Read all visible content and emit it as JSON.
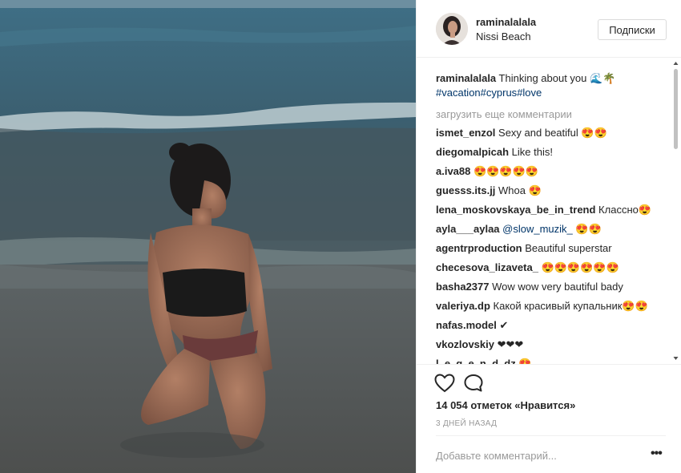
{
  "post": {
    "photo_alt": "",
    "header": {
      "username": "raminalalala",
      "location": "Nissi Beach",
      "follow_label": "Подписки"
    },
    "caption": {
      "username": "raminalalala",
      "text": " Thinking about you 🌊🌴",
      "hashtags": [
        "#vacation",
        "#cyprus",
        "#love"
      ]
    },
    "load_more_label": "загрузить еще комментарии",
    "comments": [
      {
        "username": "ismet_enzol",
        "text": " Sexy and beatiful 😍😍"
      },
      {
        "username": "diegomalpicah",
        "text": " Like this!"
      },
      {
        "username": "a.iva88",
        "text": " 😍😍😍😍😍"
      },
      {
        "username": "guesss.its.jj",
        "text": " Whoa 😍"
      },
      {
        "username": "lena_moskovskaya_be_in_trend",
        "text": " Классно😍"
      },
      {
        "username": "ayla___aylaa",
        "mention": "@slow_muzik_",
        "text": " 😍😍"
      },
      {
        "username": "agentrproduction",
        "text": " Beautiful superstar"
      },
      {
        "username": "checesova_lizaveta_",
        "text": " 😍😍😍😍😍😍"
      },
      {
        "username": "basha2377",
        "text": " Wow wow very bautiful bady"
      },
      {
        "username": "valeriya.dp",
        "text": " Какой красивый купальник😍😍"
      },
      {
        "username": "nafas.model",
        "text": " ✔"
      },
      {
        "username": "vkozlovskiy",
        "text": " ❤❤❤"
      },
      {
        "username": "l_e_g_e_n_d_dz",
        "text": " 😍"
      }
    ],
    "likes_label": "14 054 отметок «Нравится»",
    "time_label": "3 ДНЕЙ НАЗАД",
    "add_comment_placeholder": "Добавьте комментарий...",
    "more_label": "•••",
    "icons": {
      "like": "heart-outline-icon",
      "comment": "speech-bubble-icon",
      "more": "ellipsis-icon"
    },
    "colors": {
      "text": "#262626",
      "secondary": "#999999",
      "hashtag": "#003569",
      "border": "#efefef"
    }
  }
}
